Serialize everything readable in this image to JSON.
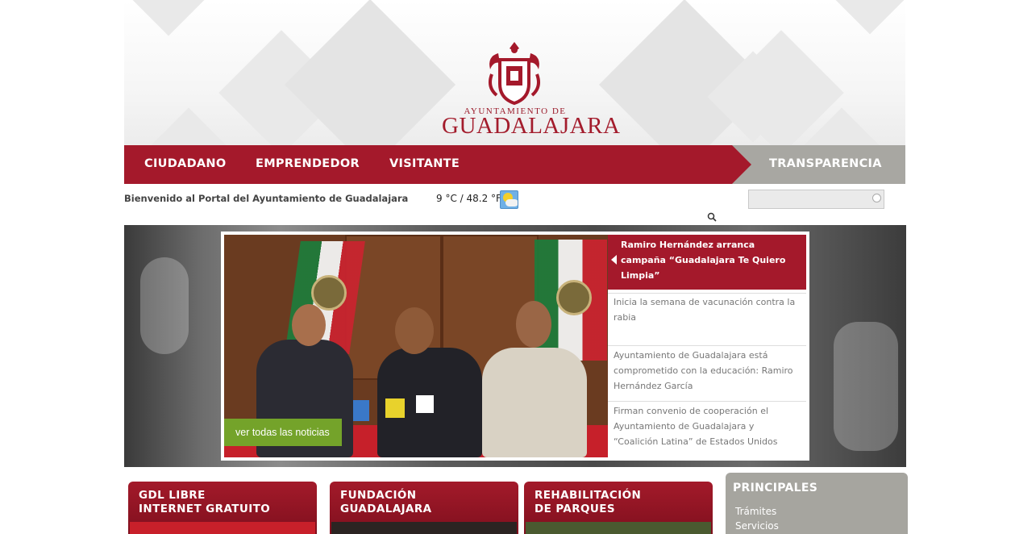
{
  "header": {
    "logo_line1": "AYUNTAMIENTO DE",
    "logo_line2": "GUADALAJARA"
  },
  "nav": {
    "items": [
      "CIUDADANO",
      "EMPRENDEDOR",
      "VISITANTE"
    ],
    "right_item": "TRANSPARENCIA"
  },
  "welcome_text": "Bienvenido al Portal del Ayuntamiento de Guadalajara",
  "weather": {
    "text": "9 °C / 48.2 °F",
    "icon": "partly-cloudy-icon"
  },
  "search": {
    "value": "",
    "icon": "search-icon"
  },
  "hero": {
    "ver_todas": "ver todas las noticias",
    "news": [
      "Ramiro Hernández arranca campaña “Guadalajara Te Quiero Limpia”",
      "Inicia la semana de vacunación contra la rabia",
      "Ayuntamiento de Guadalajara está comprometido con la educación: Ramiro Hernández García",
      "Firman convenio de cooperación el Ayuntamiento de Guadalajara y “Coalición Latina” de Estados Unidos"
    ]
  },
  "cards": [
    {
      "line1": "GDL LIBRE",
      "line2": "INTERNET GRATUITO"
    },
    {
      "line1": "FUNDACIÓN",
      "line2": "GUADALAJARA"
    },
    {
      "line1": "REHABILITACIÓN",
      "line2": "DE PARQUES"
    }
  ],
  "principales": {
    "title": "PRINCIPALES",
    "links": [
      "Trámites",
      "Servicios"
    ]
  },
  "colors": {
    "brand_red": "#a4192b",
    "nav_gray": "#a8a7a2",
    "green_button": "#74a32a"
  }
}
